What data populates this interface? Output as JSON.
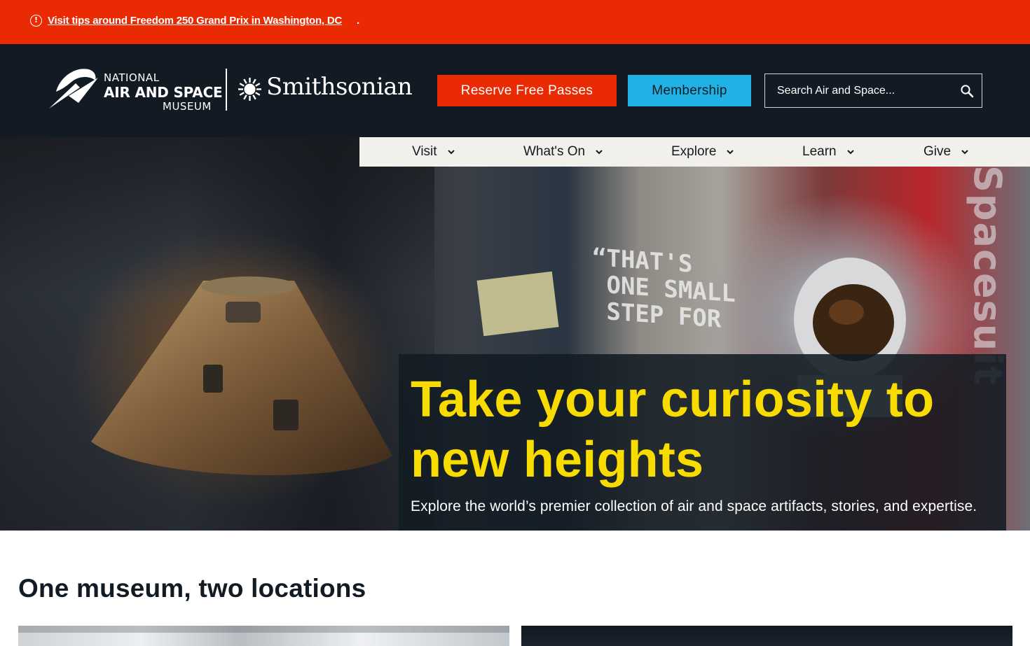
{
  "alert": {
    "icon": "alert-circle-icon",
    "link_text": "Visit tips around Freedom 250 Grand Prix in Washington, DC",
    "suffix": "."
  },
  "header": {
    "logo": {
      "line1": "NATIONAL",
      "line2": "AIR AND SPACE",
      "line3": "MUSEUM",
      "partner": "Smithsonian"
    },
    "reserve_label": "Reserve Free Passes",
    "membership_label": "Membership",
    "search_placeholder": "Search Air and Space...",
    "colors": {
      "header_bg": "#121b23",
      "reserve": "#ea2a02",
      "membership": "#21b2e5"
    }
  },
  "nav": {
    "items": [
      {
        "label": "Visit"
      },
      {
        "label": "What's On"
      },
      {
        "label": "Explore"
      },
      {
        "label": "Learn"
      },
      {
        "label": "Give"
      }
    ]
  },
  "hero": {
    "title": "Take your curiosity to new heights",
    "subtitle": "Explore the world’s premier collection of air and space artifacts, stories, and expertise.",
    "title_color": "#f8dc00"
  },
  "locations": {
    "title": "One museum, two locations"
  }
}
